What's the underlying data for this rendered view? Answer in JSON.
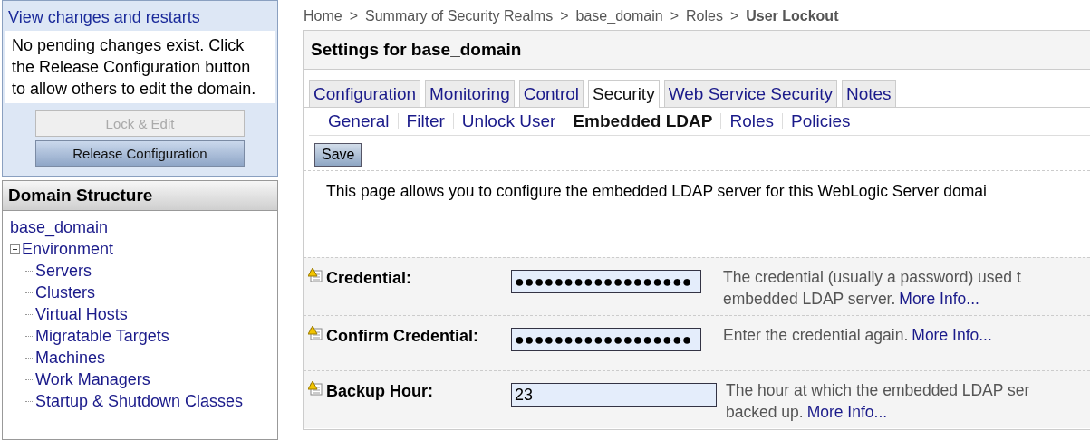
{
  "change_center": {
    "title": "View changes and restarts",
    "message": "No pending changes exist. Click the Release Configuration button to allow others to edit the domain.",
    "buttons": [
      {
        "label": "Lock & Edit",
        "disabled": true
      },
      {
        "label": "Release Configuration",
        "disabled": false
      }
    ]
  },
  "domain_structure": {
    "title": "Domain Structure",
    "tree": [
      {
        "label": "base_domain",
        "children": [
          {
            "label": "Environment",
            "expanded": true,
            "children": [
              {
                "label": "Servers"
              },
              {
                "label": "Clusters"
              },
              {
                "label": "Virtual Hosts"
              },
              {
                "label": "Migratable Targets"
              },
              {
                "label": "Machines"
              },
              {
                "label": "Work Managers"
              },
              {
                "label": "Startup & Shutdown Classes"
              }
            ]
          }
        ]
      }
    ]
  },
  "breadcrumb": [
    {
      "label": "Home",
      "current": false
    },
    {
      "label": "Summary of Security Realms",
      "current": false
    },
    {
      "label": "base_domain",
      "current": false
    },
    {
      "label": "Roles",
      "current": false
    },
    {
      "label": "User Lockout",
      "current": true
    }
  ],
  "breadcrumb_separator": ">",
  "settings": {
    "title": "Settings for base_domain",
    "tabs": [
      {
        "label": "Configuration",
        "selected": false
      },
      {
        "label": "Monitoring",
        "selected": false
      },
      {
        "label": "Control",
        "selected": false
      },
      {
        "label": "Security",
        "selected": true
      },
      {
        "label": "Web Service Security",
        "selected": false
      },
      {
        "label": "Notes",
        "selected": false
      }
    ],
    "subtabs": [
      {
        "label": "General",
        "selected": false
      },
      {
        "label": "Filter",
        "selected": false
      },
      {
        "label": "Unlock User",
        "selected": false
      },
      {
        "label": "Embedded LDAP",
        "selected": true
      },
      {
        "label": "Roles",
        "selected": false
      },
      {
        "label": "Policies",
        "selected": false
      }
    ],
    "save_button": "Save",
    "description": "This page allows you to configure the embedded LDAP server for this WebLogic Server domai",
    "fields": [
      {
        "label": "Credential:",
        "value": "●●●●●●●●●●●●●●●●●●",
        "help": [
          "The credential (usually a password) used t",
          "embedded LDAP server."
        ],
        "link": "More Info..."
      },
      {
        "label": "Confirm Credential:",
        "value": "●●●●●●●●●●●●●●●●●●",
        "help": [
          "Enter the credential again."
        ],
        "link": "More Info..."
      },
      {
        "label": "Backup Hour:",
        "value": "23",
        "help": [
          "The hour at which the embedded LDAP ser",
          "backed up."
        ],
        "link": "More Info..."
      }
    ]
  }
}
